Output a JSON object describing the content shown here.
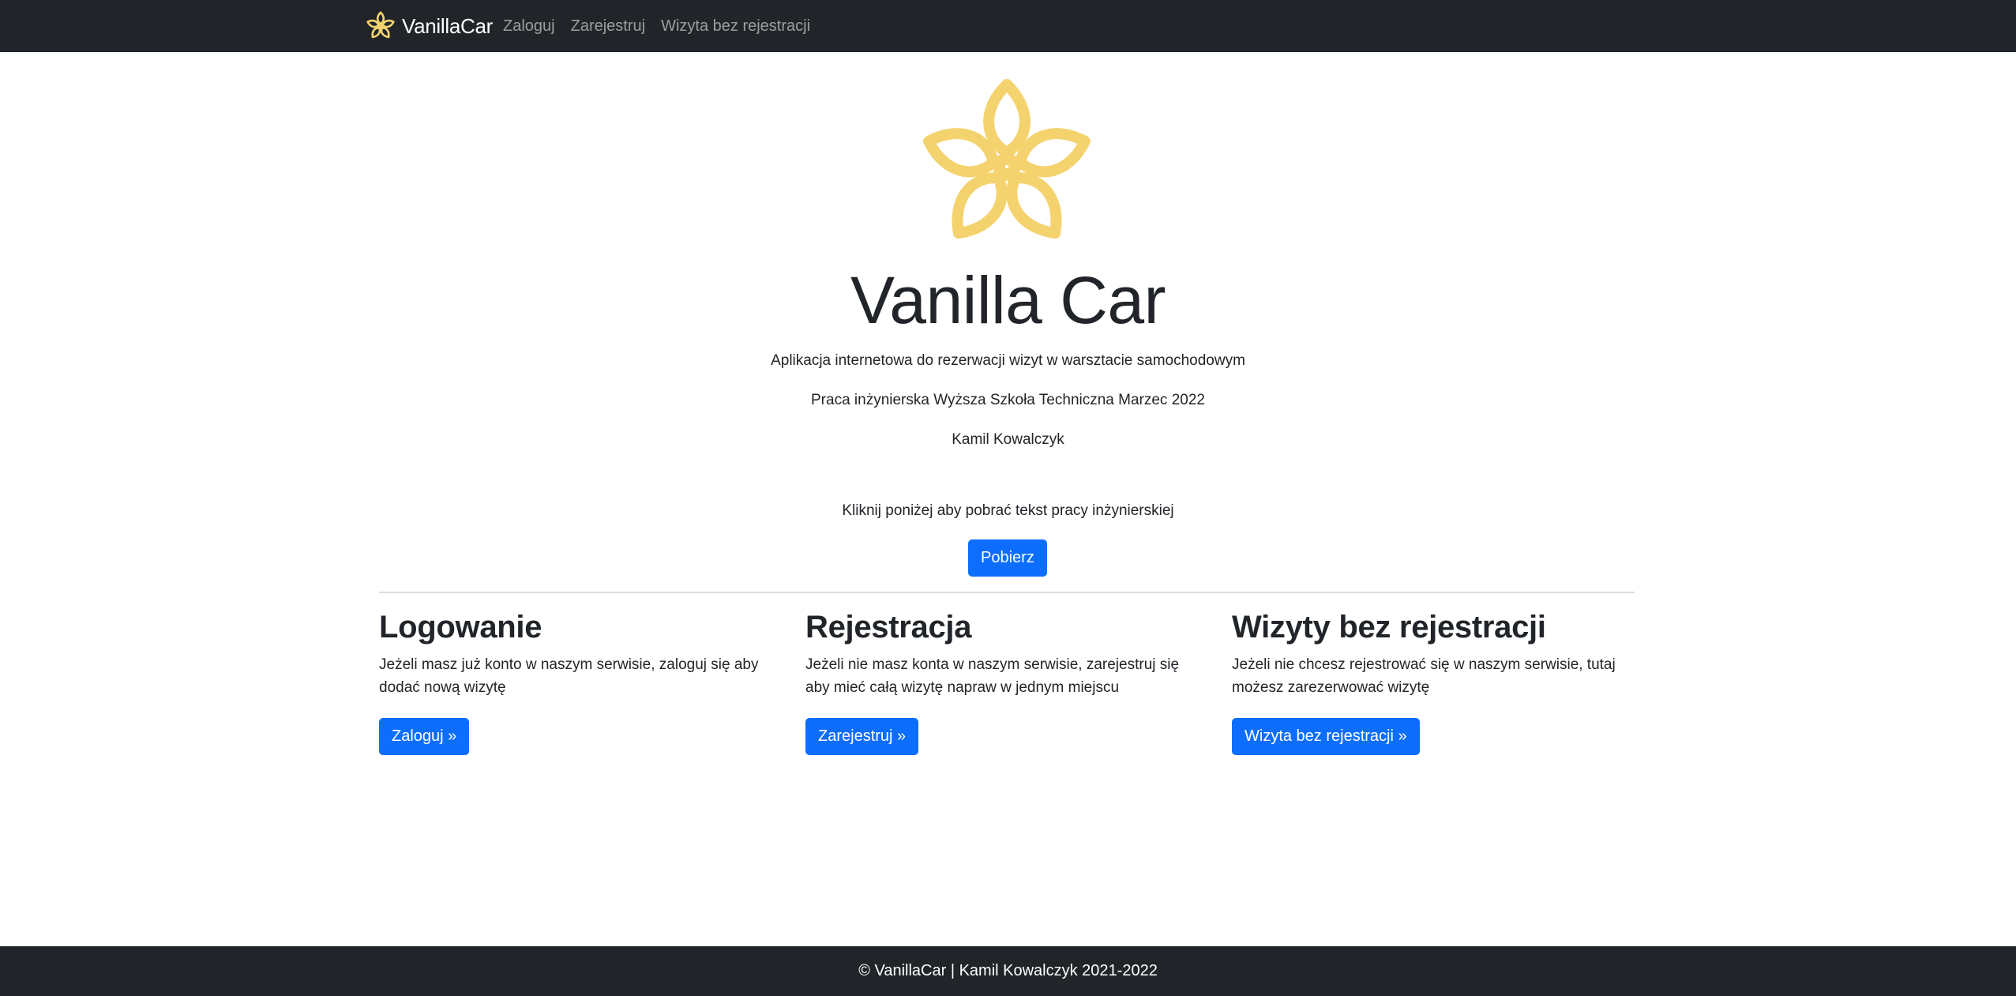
{
  "navbar": {
    "brand": "VanillaCar",
    "links": [
      "Zaloguj",
      "Zarejestruj",
      "Wizyta bez rejestracji"
    ]
  },
  "hero": {
    "title": "Vanilla Car",
    "subtitle": "Aplikacja internetowa do rezerwacji wizyt w warsztacie samochodowym",
    "thesis": "Praca inżynierska Wyższa Szkoła Techniczna Marzec 2022",
    "author": "Kamil Kowalczyk",
    "download_prompt": "Kliknij poniżej aby pobrać tekst pracy inżynierskiej",
    "download_button": "Pobierz"
  },
  "features": [
    {
      "title": "Logowanie",
      "text": "Jeżeli masz już konto w naszym serwisie, zaloguj się aby dodać nową wizytę",
      "button": "Zaloguj »"
    },
    {
      "title": "Rejestracja",
      "text": "Jeżeli nie masz konta w naszym serwisie, zarejestruj się aby mieć całą wizytę napraw w jednym miejscu",
      "button": "Zarejestruj »"
    },
    {
      "title": "Wizyty bez rejestracji",
      "text": "Jeżeli nie chcesz rejestrować się w naszym serwisie, tutaj możesz zarezerwować wizytę",
      "button": "Wizyta bez rejestracji »"
    }
  ],
  "footer": {
    "text": "© VanillaCar | Kamil Kowalczyk 2021-2022"
  },
  "icons": {
    "brand_logo": "flower-icon",
    "hero_logo": "flower-icon"
  },
  "colors": {
    "navbar_bg": "#212529",
    "primary": "#0d6efd",
    "logo_yellow": "#f4d36f",
    "nav_link": "rgba(255,255,255,0.55)"
  }
}
